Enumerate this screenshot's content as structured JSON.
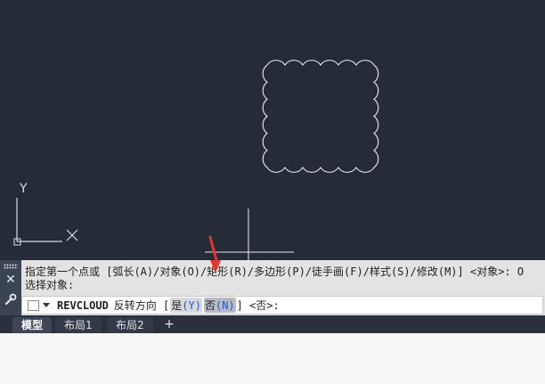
{
  "canvas": {
    "ucs_y_label": "Y",
    "ucs_x_label": "X"
  },
  "command": {
    "history_line1": "指定第一个点或 [弧长(A)/对象(O)/矩形(R)/多边形(P)/徒手画(F)/样式(S)/修改(M)] <对象>: O",
    "history_line2": "选择对象:",
    "command_name": "REVCLOUD",
    "prompt_text": "反转方向 [",
    "option_yes_text": "是",
    "option_yes_key": "(Y)",
    "option_no_text": "否",
    "option_no_key": "(N)",
    "prompt_suffix": "] <否>:"
  },
  "toolbar": {
    "close_icon": "close-icon",
    "customize_icon": "wrench-icon"
  },
  "tabs": [
    {
      "label": "模型",
      "active": true
    },
    {
      "label": "布局1",
      "active": false
    },
    {
      "label": "布局2",
      "active": false
    }
  ],
  "add_tab_label": "+",
  "colors": {
    "canvas_bg": "#252c38",
    "pointer_arrow": "#e8322f",
    "option_key": "#2b56c5"
  }
}
